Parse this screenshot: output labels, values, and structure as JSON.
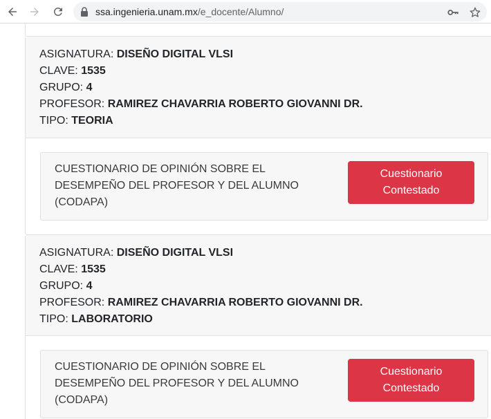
{
  "browser": {
    "url_host": "ssa.ingenieria.unam.mx",
    "url_path": "/e_docente/Alumno/"
  },
  "courses": [
    {
      "asignatura_label": "ASIGNATURA:",
      "asignatura": "DISEÑO DIGITAL VLSI",
      "clave_label": "CLAVE:",
      "clave": "1535",
      "grupo_label": "GRUPO:",
      "grupo": "4",
      "profesor_label": "PROFESOR:",
      "profesor": "RAMIREZ CHAVARRIA ROBERTO GIOVANNI DR.",
      "tipo_label": "TIPO:",
      "tipo": "TEORIA",
      "survey_text": "CUESTIONARIO DE OPINIÓN SOBRE EL DESEMPEÑO DEL PROFESOR Y DEL ALUMNO (CODAPA)",
      "survey_button": "Cuestionario Contestado"
    },
    {
      "asignatura_label": "ASIGNATURA:",
      "asignatura": "DISEÑO DIGITAL VLSI",
      "clave_label": "CLAVE:",
      "clave": "1535",
      "grupo_label": "GRUPO:",
      "grupo": "4",
      "profesor_label": "PROFESOR:",
      "profesor": "RAMIREZ CHAVARRIA ROBERTO GIOVANNI DR.",
      "tipo_label": "TIPO:",
      "tipo": "LABORATORIO",
      "survey_text": "CUESTIONARIO DE OPINIÓN SOBRE EL DESEMPEÑO DEL PROFESOR Y DEL ALUMNO (CODAPA)",
      "survey_button": "Cuestionario Contestado"
    }
  ],
  "colors": {
    "button_bg": "#dc3545",
    "header_bg": "#f7f7f7",
    "border": "#dee2e6"
  }
}
